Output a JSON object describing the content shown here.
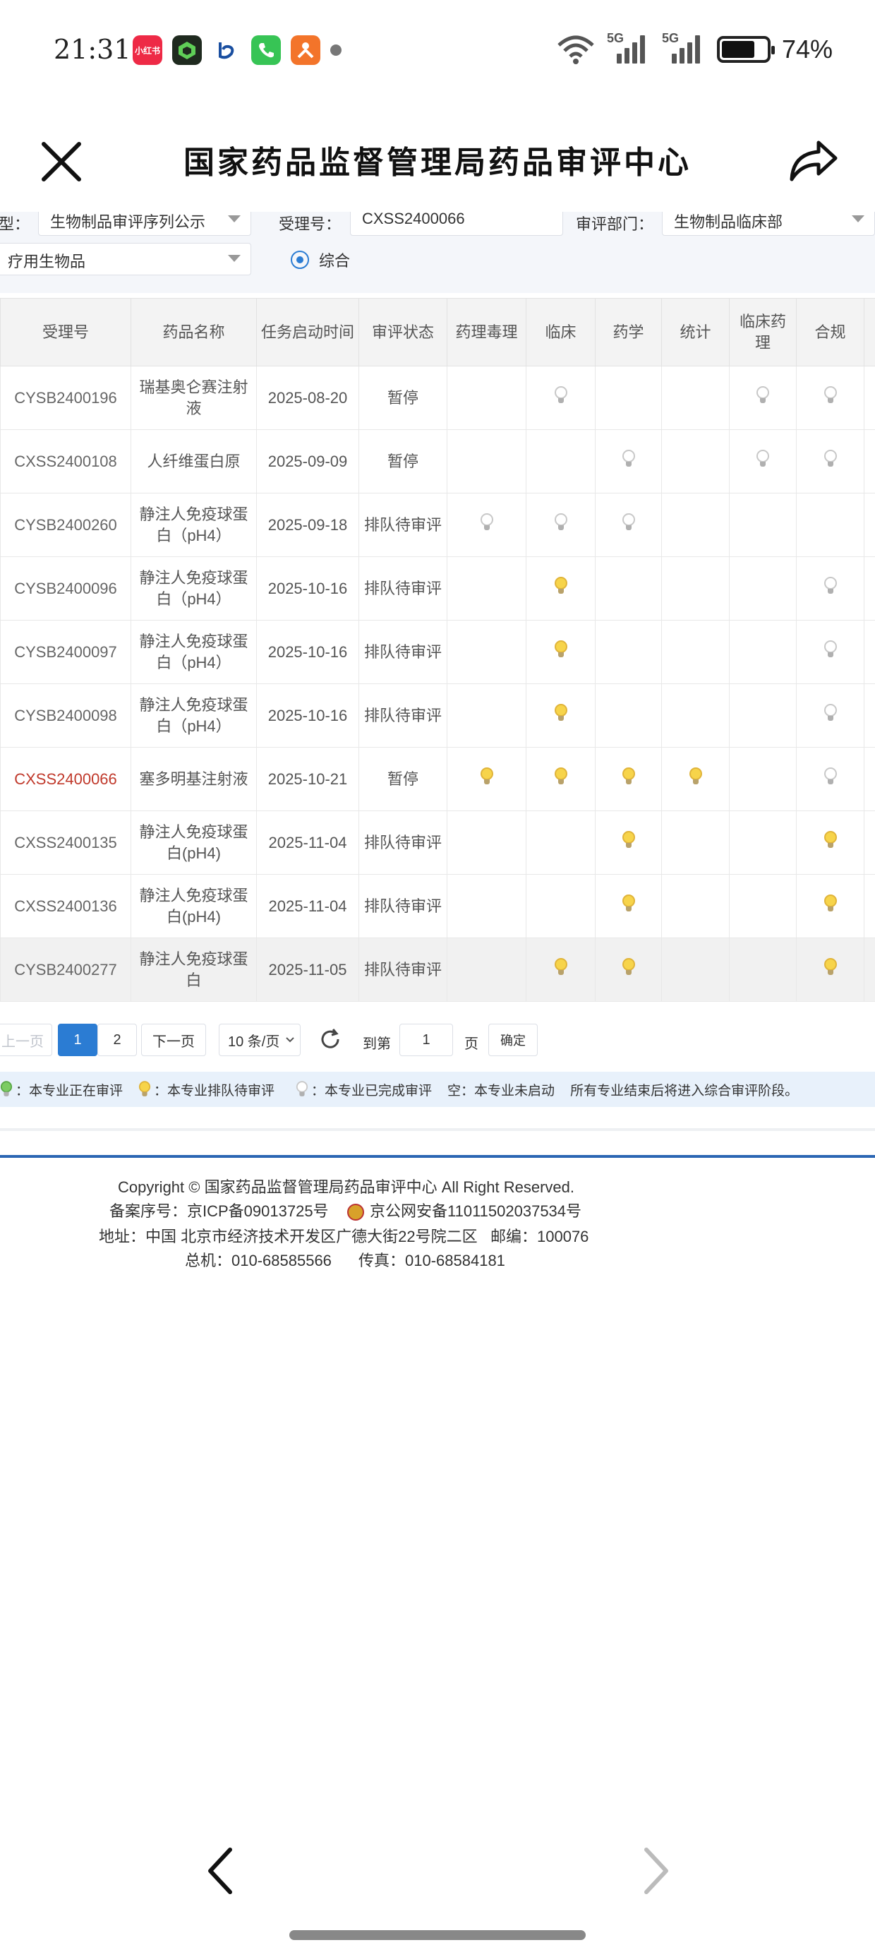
{
  "status_bar": {
    "time": "21:31",
    "apps": [
      {
        "name": "xiaohongshu-app-icon",
        "label": "小红书",
        "color": "#ee2a46"
      },
      {
        "name": "green-cube-app-icon",
        "label": "",
        "color": "#1f2a1f"
      },
      {
        "name": "blue-app-icon",
        "label": "",
        "color": "#ffffff"
      },
      {
        "name": "phone-app-icon",
        "label": "",
        "color": "#37c455"
      },
      {
        "name": "orange-app-icon",
        "label": "",
        "color": "#f3742a"
      }
    ],
    "network1": "5G",
    "network2": "5G",
    "battery": "74%",
    "battery_level": 0.74
  },
  "header": {
    "title": "国家药品监督管理局药品审评中心"
  },
  "filters": {
    "type_label": "型：",
    "type_value": "生物制品审评序列公示",
    "accept_label": "受理号：",
    "accept_value": "CXSS2400066",
    "dept_label": "审评部门：",
    "dept_value": "生物制品临床部",
    "category_value": "疗用生物品",
    "radio_label": "综合"
  },
  "table": {
    "headers": [
      "受理号",
      "药品名称",
      "任务启动时间",
      "审评状态",
      "药理毒理",
      "临床",
      "药学",
      "统计",
      "临床药理",
      "合规"
    ],
    "rows": [
      {
        "id": "CYSB2400196",
        "name": "瑞基奥仑赛注射液",
        "date": "2025-08-20",
        "status": "暂停",
        "bulbs": [
          "",
          "gray",
          "",
          "",
          "gray",
          "gray"
        ]
      },
      {
        "id": "CXSS2400108",
        "name": "人纤维蛋白原",
        "date": "2025-09-09",
        "status": "暂停",
        "bulbs": [
          "",
          "",
          "gray",
          "",
          "gray",
          "gray"
        ]
      },
      {
        "id": "CYSB2400260",
        "name": "静注人免疫球蛋白（pH4）",
        "date": "2025-09-18",
        "status": "排队待审评",
        "bulbs": [
          "gray",
          "gray",
          "gray",
          "",
          "",
          ""
        ]
      },
      {
        "id": "CYSB2400096",
        "name": "静注人免疫球蛋白（pH4）",
        "date": "2025-10-16",
        "status": "排队待审评",
        "bulbs": [
          "",
          "yellow",
          "",
          "",
          "",
          "gray"
        ]
      },
      {
        "id": "CYSB2400097",
        "name": "静注人免疫球蛋白（pH4）",
        "date": "2025-10-16",
        "status": "排队待审评",
        "bulbs": [
          "",
          "yellow",
          "",
          "",
          "",
          "gray"
        ]
      },
      {
        "id": "CYSB2400098",
        "name": "静注人免疫球蛋白（pH4）",
        "date": "2025-10-16",
        "status": "排队待审评",
        "bulbs": [
          "",
          "yellow",
          "",
          "",
          "",
          "gray"
        ]
      },
      {
        "id": "CXSS2400066",
        "name": "塞多明基注射液",
        "date": "2025-10-21",
        "status": "暂停",
        "bulbs": [
          "yellow",
          "yellow",
          "yellow",
          "yellow",
          "",
          "gray"
        ],
        "highlight_id": true
      },
      {
        "id": "CXSS2400135",
        "name": "静注人免疫球蛋白(pH4)",
        "date": "2025-11-04",
        "status": "排队待审评",
        "bulbs": [
          "",
          "",
          "yellow",
          "",
          "",
          "yellow"
        ]
      },
      {
        "id": "CXSS2400136",
        "name": "静注人免疫球蛋白(pH4)",
        "date": "2025-11-04",
        "status": "排队待审评",
        "bulbs": [
          "",
          "",
          "yellow",
          "",
          "",
          "yellow"
        ]
      },
      {
        "id": "CYSB2400277",
        "name": "静注人免疫球蛋白",
        "date": "2025-11-05",
        "status": "排队待审评",
        "bulbs": [
          "",
          "yellow",
          "yellow",
          "",
          "",
          "yellow"
        ],
        "hover": true
      }
    ]
  },
  "pager": {
    "prev": "上一页",
    "page1": "1",
    "page2": "2",
    "next": "下一页",
    "page_size": "10 条/页",
    "goto": "到第",
    "goto_value": "1",
    "page_unit": "页",
    "confirm": "确定"
  },
  "legend": {
    "in_review": "：本专业正在审评",
    "queued": "：本专业排队待审评",
    "done": "：本专业已完成审评",
    "empty": "空：本专业未启动",
    "note": "所有专业结束后将进入综合审评阶段。"
  },
  "footer": {
    "copyright": "Copyright © 国家药品监督管理局药品审评中心   All Right Reserved.",
    "icp": "备案序号：京ICP备09013725号",
    "police": "京公网安备11011502037534号",
    "address": "地址：中国 北京市经济技术开发区广德大街22号院二区",
    "postcode": "邮编：100076",
    "phone": "总机：010-68585566",
    "fax": "传真：010-68584181"
  }
}
